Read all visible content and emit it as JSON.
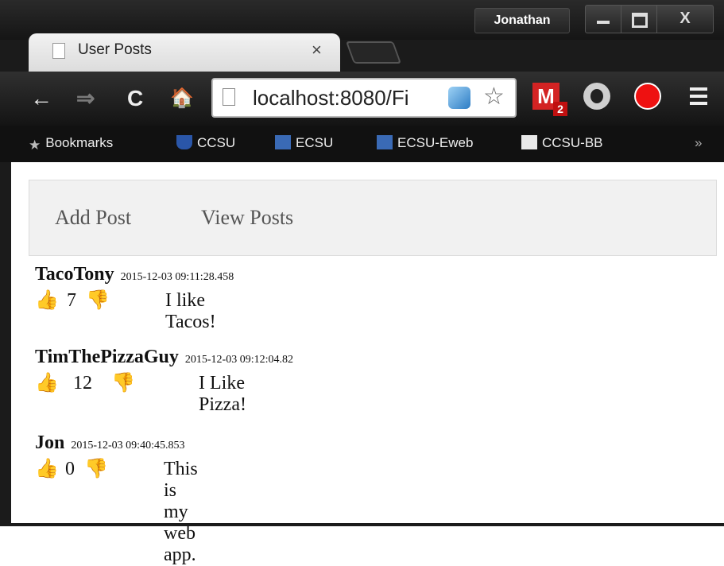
{
  "browser": {
    "profile_name": "Jonathan",
    "close_glyph": "X",
    "tab": {
      "title": "User Posts",
      "close_glyph": "×"
    },
    "nav": {
      "back": "←",
      "forward": "⇒",
      "reload": "C",
      "home": "🏠"
    },
    "address": {
      "url": "localhost:8080/Fi"
    },
    "extensions": {
      "gmail_label": "M",
      "gmail_badge": "2"
    },
    "bookmarks": [
      {
        "label": "Bookmarks"
      },
      {
        "label": "CCSU"
      },
      {
        "label": "ECSU"
      },
      {
        "label": "ECSU-Eweb"
      },
      {
        "label": "CCSU-BB"
      }
    ],
    "bookmarks_overflow": "»"
  },
  "page": {
    "nav": [
      {
        "label": "Add Post"
      },
      {
        "label": "View Posts"
      }
    ],
    "posts": [
      {
        "author": "TacoTony",
        "timestamp": "2015-12-03 09:11:28.458",
        "likes": "7",
        "text": "I like Tacos!"
      },
      {
        "author": "TimThePizzaGuy",
        "timestamp": "2015-12-03 09:12:04.82",
        "likes": "12",
        "text": "I Like Pizza!"
      },
      {
        "author": "Jon",
        "timestamp": "2015-12-03 09:40:45.853",
        "likes": "0",
        "text": "This is my web app."
      }
    ]
  },
  "icons": {
    "thumbs_up": "👍",
    "thumbs_down": "👎"
  }
}
